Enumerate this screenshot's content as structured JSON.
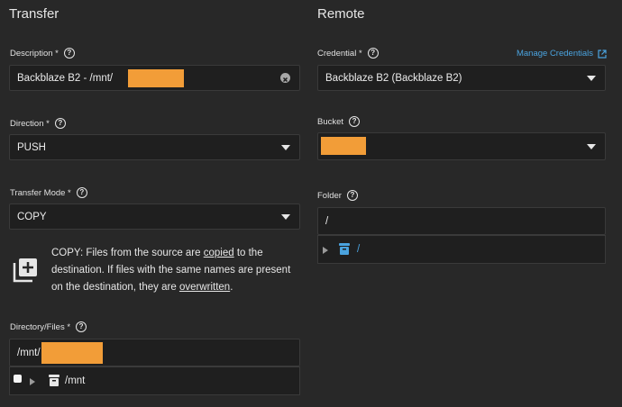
{
  "transfer": {
    "title": "Transfer",
    "description_label": "Description *",
    "description_value": "Backblaze B2 - /mnt/",
    "direction_label": "Direction *",
    "direction_value": "PUSH",
    "mode_label": "Transfer Mode *",
    "mode_value": "COPY",
    "note": {
      "part1": "COPY: Files from the source are ",
      "link1": "copied",
      "part2": " to the destination. If files with the same names are present on the destination, they are ",
      "link2": "overwritten",
      "part3": "."
    },
    "dir_label": "Directory/Files *",
    "dir_value": "/mnt/",
    "tree_item": "/mnt"
  },
  "remote": {
    "title": "Remote",
    "credential_label": "Credential *",
    "manage_link": "Manage Credentials",
    "credential_value": "Backblaze B2 (Backblaze B2)",
    "bucket_label": "Bucket",
    "folder_label": "Folder",
    "folder_value": "/",
    "tree_item": "/"
  },
  "colors": {
    "background": "#282828",
    "field": "#1f1f1f",
    "accent": "#4aa3df",
    "redaction": "#f29d38",
    "folder_icon_remote": "#4aa3df"
  },
  "icons": {
    "help": "help-circle-icon",
    "clear": "clear-circle-icon",
    "caret": "dropdown-caret-icon",
    "external": "external-link-icon",
    "copy_mode": "library-add-icon",
    "folder": "archive-folder-icon",
    "expand": "expand-triangle-icon"
  }
}
